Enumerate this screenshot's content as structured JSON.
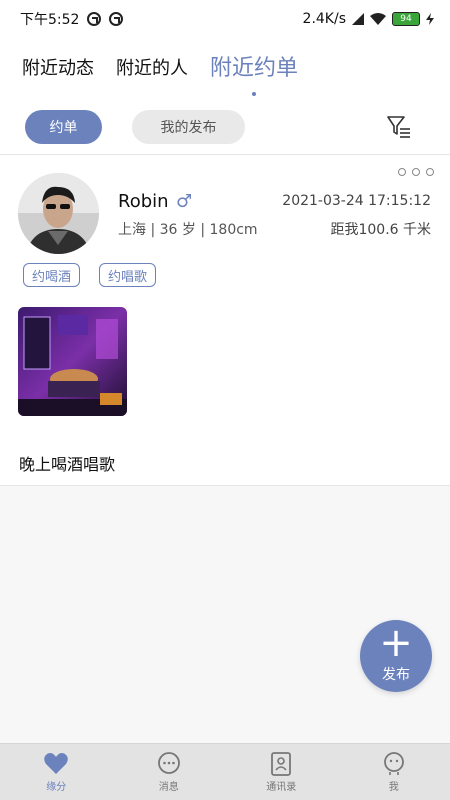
{
  "status_bar": {
    "time": "下午5:52",
    "network_speed": "2.4K/s",
    "battery": "94"
  },
  "top_tabs": [
    {
      "label": "附近动态",
      "active": false
    },
    {
      "label": "附近的人",
      "active": false
    },
    {
      "label": "附近约单",
      "active": true
    }
  ],
  "filter": {
    "pill_active": "约单",
    "pill_inactive": "我的发布"
  },
  "post": {
    "username": "Robin",
    "gender_symbol": "♂",
    "info": "上海 | 36 岁 | 180cm",
    "time": "2021-03-24 17:15:12",
    "distance": "距我100.6 千米",
    "tags": [
      "约喝酒",
      "约唱歌"
    ],
    "text": "晚上喝酒唱歌"
  },
  "fab": {
    "label": "发布"
  },
  "bottom_nav": [
    {
      "label": "缘分",
      "icon": "heart-icon",
      "active": true
    },
    {
      "label": "消息",
      "icon": "message-icon",
      "active": false
    },
    {
      "label": "通讯录",
      "icon": "contacts-icon",
      "active": false
    },
    {
      "label": "我",
      "icon": "profile-icon",
      "active": false
    }
  ],
  "colors": {
    "accent": "#6c82bd",
    "background": "#f7f7f8"
  }
}
